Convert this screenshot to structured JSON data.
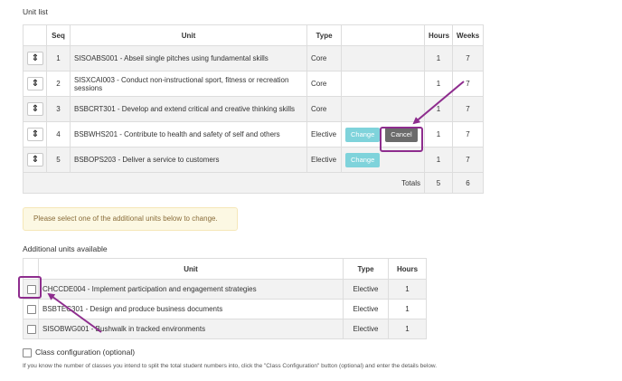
{
  "unit_list": {
    "title": "Unit list",
    "headers": [
      "",
      "Seq",
      "Unit",
      "Type",
      "",
      "Hours",
      "Weeks"
    ],
    "rows": [
      {
        "seq": "1",
        "unit": "SISOABS001 - Abseil single pitches using fundamental skills",
        "type": "Core",
        "hours": "1",
        "weeks": "7"
      },
      {
        "seq": "2",
        "unit": "SISXCAI003 - Conduct non-instructional sport, fitness or recreation sessions",
        "type": "Core",
        "hours": "1",
        "weeks": "7"
      },
      {
        "seq": "3",
        "unit": "BSBCRT301 - Develop and extend critical and creative thinking skills",
        "type": "Core",
        "hours": "1",
        "weeks": "7"
      },
      {
        "seq": "4",
        "unit": "BSBWHS201 - Contribute to health and safety of self and others",
        "type": "Elective",
        "hours": "1",
        "weeks": "7"
      },
      {
        "seq": "5",
        "unit": "BSBOPS203 - Deliver a service to customers",
        "type": "Elective",
        "hours": "1",
        "weeks": "7"
      }
    ],
    "drag_glyph": "⇕",
    "change_label": "Change",
    "cancel_label": "Cancel",
    "totals_label": "Totals",
    "totals_hours": "5",
    "totals_weeks": "6"
  },
  "alert": {
    "text": "Please select one of the additional units below to change."
  },
  "additional_units": {
    "title": "Additional units available",
    "headers": [
      "",
      "Unit",
      "Type",
      "Hours"
    ],
    "rows": [
      {
        "unit": "CHCCDE004 - Implement participation and engagement strategies",
        "type": "Elective",
        "hours": "1"
      },
      {
        "unit": "BSBTEC301 - Design and produce business documents",
        "type": "Elective",
        "hours": "1"
      },
      {
        "unit": "SISOBWG001 - Bushwalk in tracked environments",
        "type": "Elective",
        "hours": "1"
      }
    ]
  },
  "class_config": {
    "label": "Class configuration (optional)",
    "help": "If you know the number of classes you intend to split the total student numbers into, click the \"Class Configuration\" button (optional) and enter the details below."
  },
  "colors": {
    "annotation": "#8e2d8e",
    "change_button": "#7fd3db",
    "cancel_button": "#6b6b6b",
    "alert_background": "#fcf8e3"
  }
}
